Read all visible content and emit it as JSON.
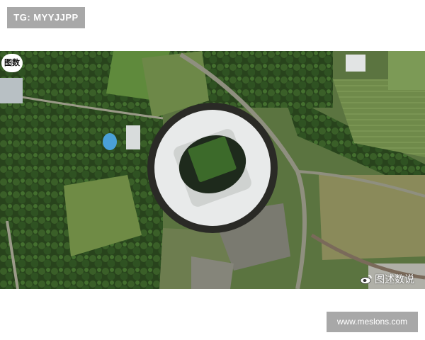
{
  "header_tag": {
    "text": "TG: MYYJJPP"
  },
  "photo": {
    "subject": "aerial view of stadium",
    "colors": {
      "grass": "#5a7a3a",
      "forest": "#2f4a22",
      "roof": "#e8eaea",
      "pitch": "#3c6a2a"
    }
  },
  "logo_badge": {
    "text": "图数"
  },
  "watermark": {
    "icon": "weibo-icon",
    "text": "图述数说"
  },
  "footer_tag": {
    "text": "www.meslons.com"
  }
}
